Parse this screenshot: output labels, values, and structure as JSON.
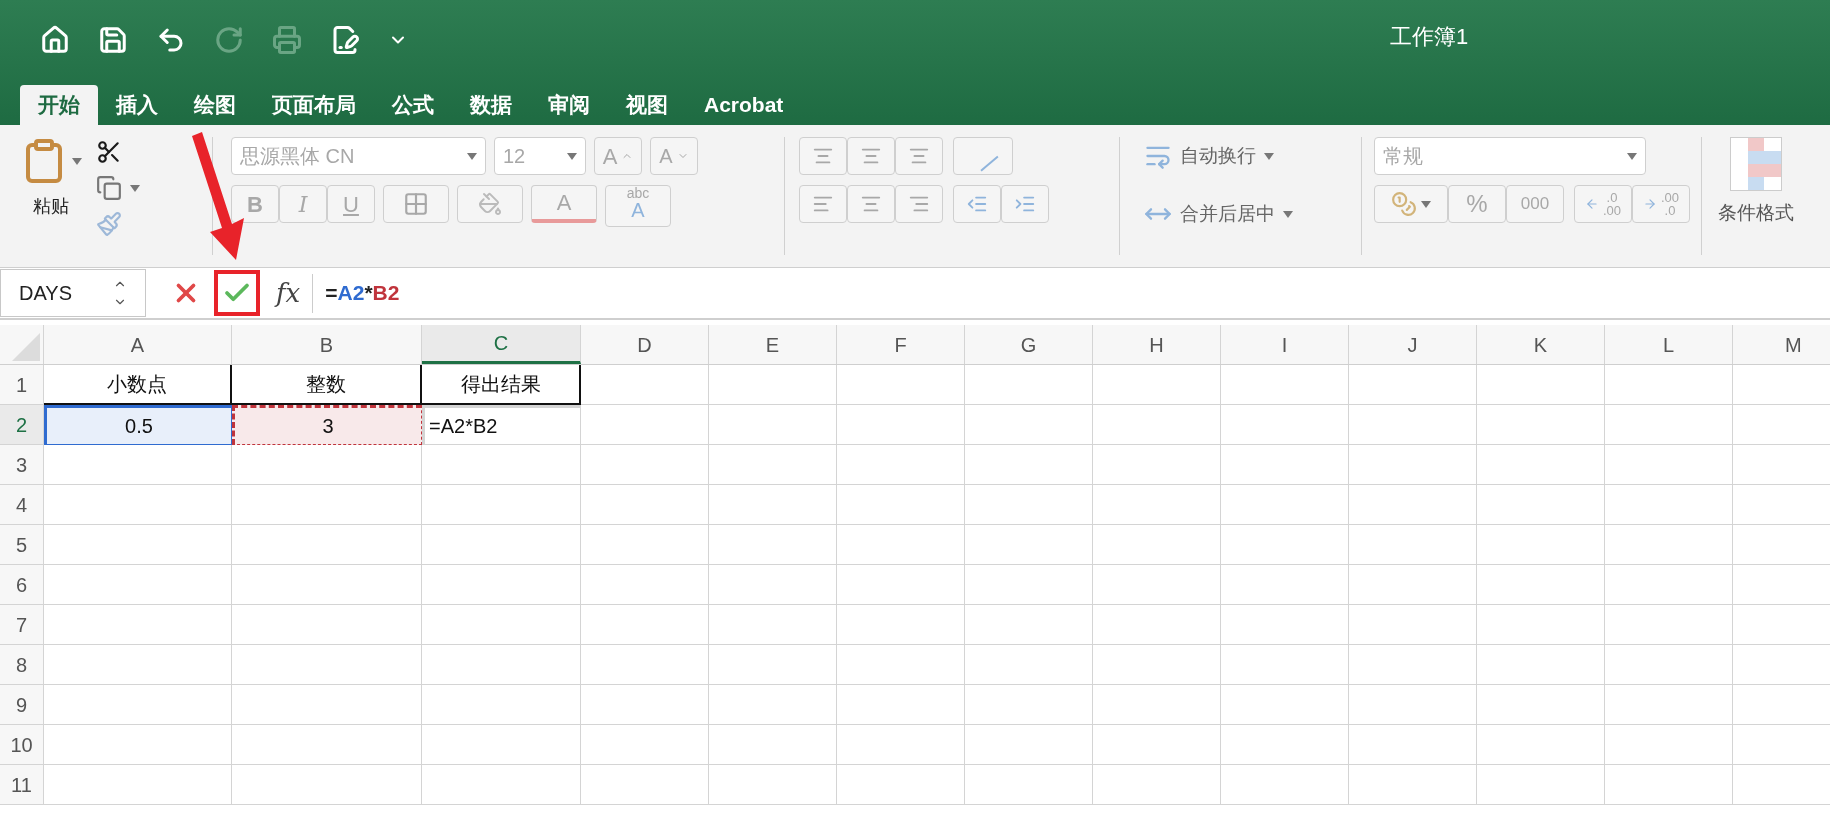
{
  "quick_access": [
    {
      "kind": "home",
      "disabled": false
    },
    {
      "kind": "save",
      "disabled": false
    },
    {
      "kind": "undo",
      "disabled": false
    },
    {
      "kind": "redo",
      "disabled": true
    },
    {
      "kind": "print",
      "disabled": true
    },
    {
      "kind": "edit",
      "disabled": false
    },
    {
      "kind": "customize",
      "disabled": false
    }
  ],
  "window": {
    "title": "工作簿1"
  },
  "tabs": [
    {
      "label": "开始",
      "selected": true
    },
    {
      "label": "插入",
      "selected": false
    },
    {
      "label": "绘图",
      "selected": false
    },
    {
      "label": "页面布局",
      "selected": false
    },
    {
      "label": "公式",
      "selected": false
    },
    {
      "label": "数据",
      "selected": false
    },
    {
      "label": "审阅",
      "selected": false
    },
    {
      "label": "视图",
      "selected": false
    },
    {
      "label": "Acrobat",
      "selected": false
    }
  ],
  "ribbon": {
    "disabled": true,
    "paste": "粘贴",
    "font_name": "思源黑体 CN",
    "font_size": "12",
    "grow_font": "A",
    "shrink_font": "A",
    "bold": "B",
    "italic": "I",
    "underline": "U",
    "font_color": "A",
    "phonetic_top": "abc",
    "phonetic_bottom": "A",
    "wrap_text": "自动换行",
    "merge_center": "合并后居中",
    "number_format": "常规",
    "percent": "%",
    "thousands": "000",
    "increase_decimal": [
      ".0",
      ".00"
    ],
    "decrease_decimal": [
      ".00",
      ".0"
    ],
    "conditional_format": "条件格式"
  },
  "formula_bar": {
    "name_box": "DAYS",
    "confirm_highlighted": true,
    "fx": "fx",
    "formula": [
      {
        "text": "=",
        "kind": "plain"
      },
      {
        "text": "A2",
        "kind": "ref",
        "color": "#2f6bd0"
      },
      {
        "text": "*",
        "kind": "plain"
      },
      {
        "text": "B2",
        "kind": "ref",
        "color": "#c0343c"
      }
    ]
  },
  "sheet": {
    "columns": [
      {
        "label": "A",
        "selected": false
      },
      {
        "label": "B",
        "selected": false
      },
      {
        "label": "C",
        "selected": true
      },
      {
        "label": "D",
        "selected": false
      },
      {
        "label": "E",
        "selected": false
      },
      {
        "label": "F",
        "selected": false
      },
      {
        "label": "G",
        "selected": false
      },
      {
        "label": "H",
        "selected": false
      },
      {
        "label": "I",
        "selected": false
      },
      {
        "label": "J",
        "selected": false
      },
      {
        "label": "K",
        "selected": false
      },
      {
        "label": "L",
        "selected": false
      },
      {
        "label": "M",
        "selected": false
      }
    ],
    "rows": [
      {
        "label": "1",
        "selected": false,
        "cells": [
          {
            "text": "小数点",
            "kind": "plain",
            "bordered": true
          },
          {
            "text": "整数",
            "kind": "plain",
            "bordered": true
          },
          {
            "text": "得出结果",
            "kind": "plain",
            "bordered": true
          }
        ]
      },
      {
        "label": "2",
        "selected": true,
        "cells": [
          {
            "text": "0.5",
            "kind": "ref",
            "color": "#2f6bd0",
            "marquee": false
          },
          {
            "text": "3",
            "kind": "ref",
            "color": "#c0343c",
            "marquee": true
          },
          {
            "text": "=A2*B2",
            "kind": "editing"
          }
        ]
      },
      {
        "label": "3",
        "selected": false
      },
      {
        "label": "4",
        "selected": false
      },
      {
        "label": "5",
        "selected": false
      },
      {
        "label": "6",
        "selected": false
      },
      {
        "label": "7",
        "selected": false
      },
      {
        "label": "8",
        "selected": false
      },
      {
        "label": "9",
        "selected": false
      },
      {
        "label": "10",
        "selected": false
      },
      {
        "label": "11",
        "selected": false
      }
    ]
  }
}
